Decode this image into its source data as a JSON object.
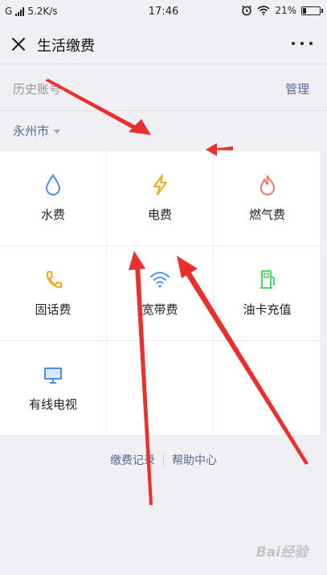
{
  "status_bar": {
    "carrier": "G",
    "speed": "5.2K/s",
    "time": "17:46",
    "battery": "21%",
    "battery_level": 0.21
  },
  "header": {
    "title": "生活缴费"
  },
  "history": {
    "label": "历史账号",
    "manage": "管理"
  },
  "city": {
    "name": "永州市"
  },
  "services": [
    {
      "label": "水费",
      "icon": "water-drop-icon",
      "color": "#4a90e2"
    },
    {
      "label": "电费",
      "icon": "lightning-icon",
      "color": "#f5a623"
    },
    {
      "label": "燃气费",
      "icon": "flame-icon",
      "color": "#f0776b"
    },
    {
      "label": "固话费",
      "icon": "phone-icon",
      "color": "#f5a623"
    },
    {
      "label": "宽带费",
      "icon": "wifi-icon",
      "color": "#4a90e2"
    },
    {
      "label": "油卡充值",
      "icon": "gas-pump-icon",
      "color": "#4cd964"
    },
    {
      "label": "有线电视",
      "icon": "tv-icon",
      "color": "#4a90e2"
    }
  ],
  "footer": {
    "records": "缴费记录",
    "help": "帮助中心"
  },
  "watermark": "Bai经验",
  "colors": {
    "link": "#576b95",
    "annotation": "#e8302c"
  }
}
